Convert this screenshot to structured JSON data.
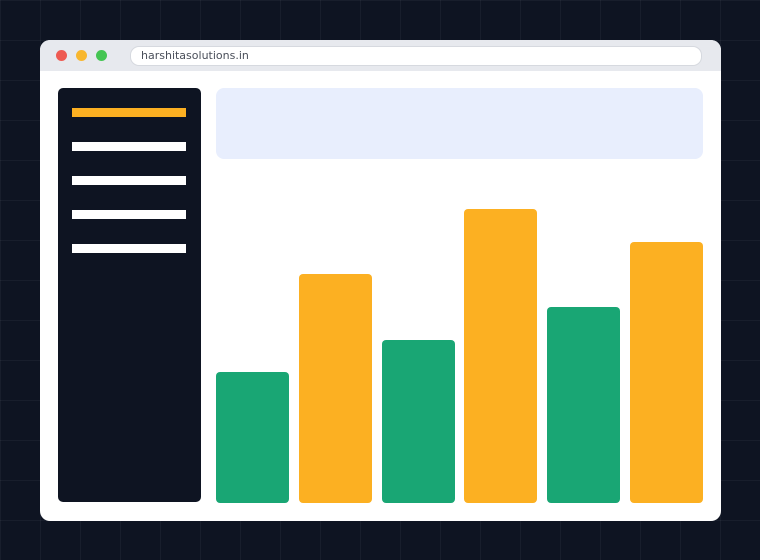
{
  "browser": {
    "url": "harshitasolutions.in",
    "window_controls": [
      "close",
      "minimize",
      "maximize"
    ]
  },
  "sidebar": {
    "items": [
      {
        "state": "active"
      },
      {
        "state": "inactive"
      },
      {
        "state": "inactive"
      },
      {
        "state": "inactive"
      },
      {
        "state": "inactive"
      }
    ]
  },
  "colors": {
    "background": "#0e1422",
    "accent_orange": "#fcb022",
    "accent_green": "#19a674",
    "banner": "#e8eefd"
  },
  "chart_data": {
    "type": "bar",
    "categories": [
      "",
      "",
      "",
      "",
      "",
      ""
    ],
    "values": [
      40,
      70,
      50,
      90,
      60,
      80
    ],
    "bar_colors": [
      "#19a674",
      "#fcb022",
      "#19a674",
      "#fcb022",
      "#19a674",
      "#fcb022"
    ],
    "ylim": [
      0,
      102
    ],
    "grid": false,
    "title": "",
    "xlabel": "",
    "ylabel": ""
  }
}
